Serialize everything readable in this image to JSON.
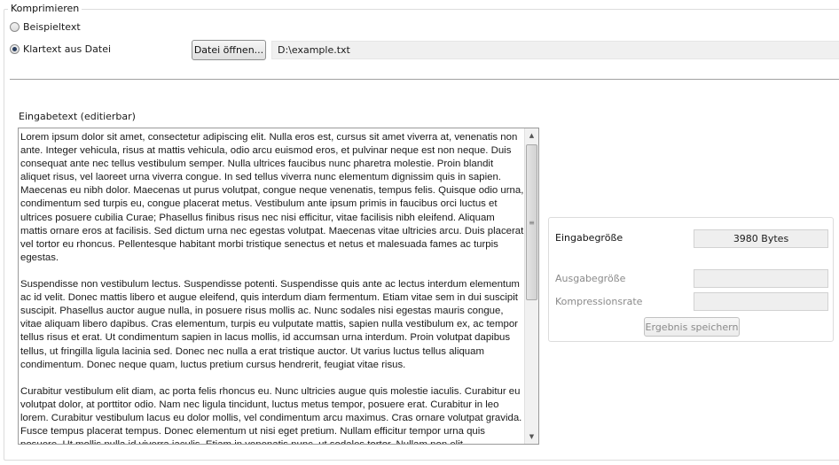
{
  "group": {
    "title": "Komprimieren"
  },
  "source": {
    "options": [
      {
        "label": "Beispieltext",
        "checked": false
      },
      {
        "label": "Klartext aus Datei",
        "checked": true
      }
    ],
    "open_button_label": "Datei öffnen...",
    "file_path": "D:\\example.txt"
  },
  "input": {
    "label": "Eingabetext (editierbar)",
    "text": "Lorem ipsum dolor sit amet, consectetur adipiscing elit. Nulla eros est, cursus sit amet viverra at, venenatis non ante. Integer vehicula, risus at mattis vehicula, odio arcu euismod eros, et pulvinar neque est non neque. Duis consequat ante nec tellus vestibulum semper. Nulla ultrices faucibus nunc pharetra molestie. Proin blandit aliquet risus, vel laoreet urna viverra congue. In sed tellus viverra nunc elementum dignissim quis in sapien. Maecenas eu nibh dolor. Maecenas ut purus volutpat, congue neque venenatis, tempus felis. Quisque odio urna, condimentum sed turpis eu, congue placerat metus. Vestibulum ante ipsum primis in faucibus orci luctus et ultrices posuere cubilia Curae; Phasellus finibus risus nec nisi efficitur, vitae facilisis nibh eleifend. Aliquam mattis ornare eros at facilisis. Sed dictum urna nec egestas volutpat. Maecenas vitae ultricies arcu. Duis placerat vel tortor eu rhoncus. Pellentesque habitant morbi tristique senectus et netus et malesuada fames ac turpis egestas.\n\nSuspendisse non vestibulum lectus. Suspendisse potenti. Suspendisse quis ante ac lectus interdum elementum ac id velit. Donec mattis libero et augue eleifend, quis interdum diam fermentum. Etiam vitae sem in dui suscipit suscipit. Phasellus auctor augue nulla, in posuere risus mollis ac. Nunc sodales nisi egestas mauris congue, vitae aliquam libero dapibus. Cras elementum, turpis eu vulputate mattis, sapien nulla vestibulum ex, ac tempor tellus risus et erat. Ut condimentum sapien in lacus mollis, id accumsan urna interdum. Proin volutpat dapibus tellus, ut fringilla ligula lacinia sed. Donec nec nulla a erat tristique auctor. Ut varius luctus tellus aliquam condimentum. Donec neque quam, luctus pretium cursus hendrerit, feugiat vitae risus.\n\nCurabitur vestibulum elit diam, ac porta felis rhoncus eu. Nunc ultricies augue quis molestie iaculis. Curabitur eu volutpat dolor, at porttitor odio. Nam nec ligula tincidunt, luctus metus tempor, posuere erat. Curabitur in leo lorem. Curabitur vestibulum lacus eu dolor mollis, vel condimentum arcu maximus. Cras ornare volutpat gravida. Fusce tempus placerat tempus. Donec elementum ut nisi eget pretium. Nullam efficitur tempor urna quis posuere. Ut mollis nulla id viverra iaculis. Etiam in venenatis nunc, ut sodales tortor. Nullam non elit"
  },
  "result": {
    "input_size_label": "Eingabegröße",
    "input_size_value": "3980 Bytes",
    "output_size_label": "Ausgabegröße",
    "output_size_value": "",
    "ratio_label": "Kompressionsrate",
    "ratio_value": "",
    "save_button_label": "Ergebnis speichern"
  },
  "icons": {
    "scroll_up": "triangle-up",
    "scroll_down": "triangle-down",
    "thumb_grip": "grip-lines"
  }
}
